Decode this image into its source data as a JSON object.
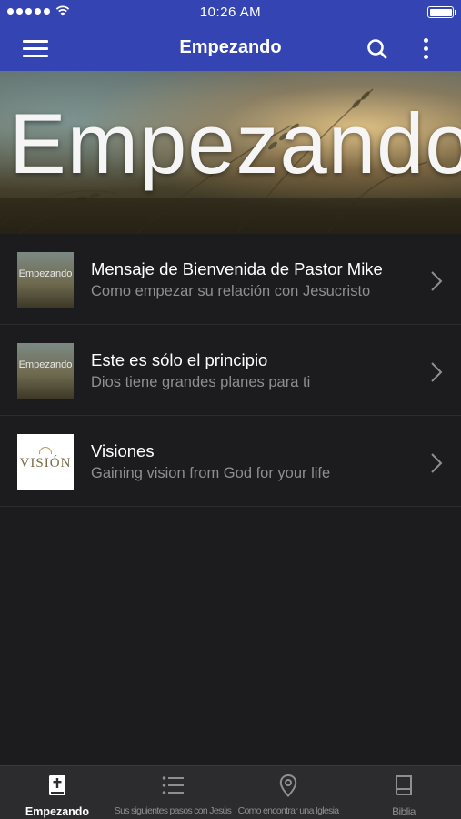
{
  "status_bar": {
    "time": "10:26 AM"
  },
  "header": {
    "title": "Empezando",
    "icons": [
      "menu-icon",
      "search-icon",
      "more-vertical-icon"
    ]
  },
  "hero": {
    "text": "Empezando"
  },
  "list": {
    "items": [
      {
        "thumb_text": "Empezando",
        "title": "Mensaje de Bienvenida de Pastor Mike",
        "subtitle": "Como empezar su relación con Jesucristo"
      },
      {
        "thumb_text": "Empezando",
        "title": "Este es sólo el principio",
        "subtitle": "Dios tiene grandes planes para ti"
      },
      {
        "thumb_text": "VISIÓN",
        "title": "Visiones",
        "subtitle": "Gaining vision from God for your life"
      }
    ]
  },
  "tab_bar": {
    "tabs": [
      {
        "label": "Empezando",
        "icon": "bible-cross-icon",
        "active": true
      },
      {
        "label": "Sus siguientes pasos con Jesús",
        "icon": "list-icon",
        "active": false
      },
      {
        "label": "Como encontrar una Iglesia",
        "icon": "location-pin-icon",
        "active": false
      },
      {
        "label": "Biblia",
        "icon": "book-icon",
        "active": false
      }
    ]
  },
  "colors": {
    "header_blue": "#3444b3",
    "background": "#1c1c1e",
    "subtitle_gray": "#8e8e93"
  }
}
